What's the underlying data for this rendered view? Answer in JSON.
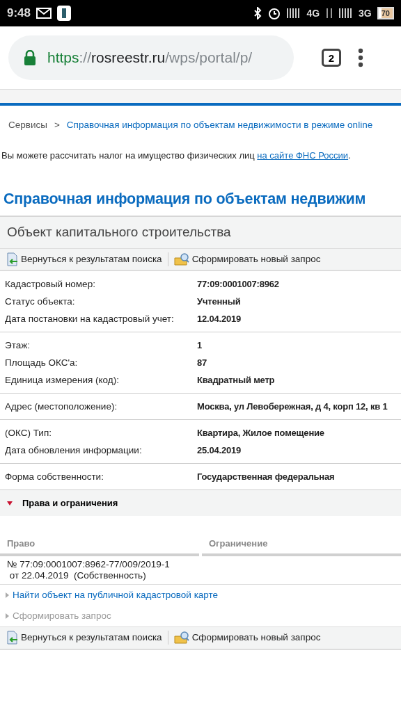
{
  "status_bar": {
    "time": "9:48",
    "network_1": "4G",
    "network_2": "3G",
    "battery": "70"
  },
  "browser": {
    "url_scheme": "https",
    "url_separator": "://",
    "url_host": "rosreestr.ru",
    "url_path": "/wps/portal/p/",
    "tab_count": "2"
  },
  "breadcrumb": [
    {
      "label": "Сервисы",
      "link": false
    },
    {
      "label": "Справочная информация по объектам недвижимости в режиме online",
      "link": true
    }
  ],
  "breadcrumb_separator": ">",
  "tax_note": {
    "text": "Вы можете рассчитать налог на имущество физических лиц ",
    "link": "на сайте ФНС России",
    "end": "."
  },
  "page_title": "Справочная информация по объектам недвижим",
  "panel_title": "Объект капитального строительства",
  "toolbar_top": [
    {
      "label": "Вернуться к результатам поиска",
      "kind": "back"
    },
    {
      "label": "Сформировать новый запрос",
      "kind": "new"
    }
  ],
  "field_groups": [
    [
      {
        "label": "Кадастровый номер:",
        "value": "77:09:0001007:8962"
      },
      {
        "label": "Статус объекта:",
        "value": "Учтенный"
      },
      {
        "label": "Дата постановки на кадастровый учет:",
        "value": "12.04.2019"
      }
    ],
    [
      {
        "label": "Этаж:",
        "value": "1"
      },
      {
        "label": "Площадь ОКС'a:",
        "value": "87"
      },
      {
        "label": "Единица измерения (код):",
        "value": "Квадратный метр"
      }
    ],
    [
      {
        "label": "Адрес (местоположение):",
        "value": "Москва, ул Левобережная, д 4, корп 12, кв 1"
      }
    ],
    [
      {
        "label": "(ОКС) Тип:",
        "value": "Квартира, Жилое помещение"
      },
      {
        "label": "Дата обновления информации:",
        "value": "25.04.2019"
      }
    ],
    [
      {
        "label": "Форма собственности:",
        "value": "Государственная федеральная"
      }
    ]
  ],
  "rights_section": {
    "title": "Права и ограничения",
    "expanded": true,
    "columns": [
      "Право",
      "Ограничение"
    ],
    "rows": [
      {
        "right_lines": [
          "№ 77:09:0001007:8962-77/009/2019-1",
          " от 22.04.2019  (Собственность)"
        ]
      }
    ]
  },
  "actions": [
    {
      "label": "Найти объект на публичной кадастровой карте",
      "disabled": false
    },
    {
      "label": "Сформировать запрос",
      "disabled": true
    }
  ],
  "toolbar_bottom": [
    {
      "label": "Вернуться к результатам поиска",
      "kind": "back"
    },
    {
      "label": "Сформировать новый запрос",
      "kind": "new"
    }
  ]
}
